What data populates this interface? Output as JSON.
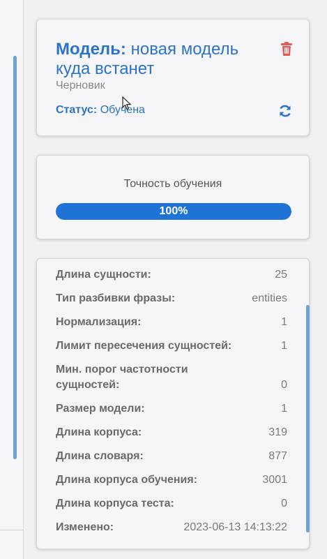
{
  "model_card": {
    "title_label": "Модель:",
    "title_value": "новая модель куда встанет",
    "draft": "Черновик",
    "status_label": "Статус:",
    "status_value": "Обучена"
  },
  "accuracy": {
    "title": "Точность обучения",
    "progress": 1.0,
    "progress_text": "100%"
  },
  "params": [
    {
      "key": "Длина сущности:",
      "value": "25"
    },
    {
      "key": "Тип разбивки фразы:",
      "value": "entities"
    },
    {
      "key": "Нормализация:",
      "value": "1"
    },
    {
      "key": "Лимит пересечения сущностей:",
      "value": "1"
    },
    {
      "key": "Мин. порог частотности сущностей:",
      "value": "0"
    },
    {
      "key": "Размер модели:",
      "value": "1"
    },
    {
      "key": "Длина корпуса:",
      "value": "319"
    },
    {
      "key": "Длина словаря:",
      "value": "877"
    },
    {
      "key": "Длина корпуса обучения:",
      "value": "3001"
    },
    {
      "key": "Длина корпуса теста:",
      "value": "0"
    },
    {
      "key": "Изменено:",
      "value": "2023-06-13 14:13:22"
    }
  ],
  "colors": {
    "accent": "#1f73d6",
    "danger": "#e05a5a",
    "link": "#2b73c8"
  },
  "icons": {
    "delete": "trash-icon",
    "refresh": "refresh-icon"
  }
}
